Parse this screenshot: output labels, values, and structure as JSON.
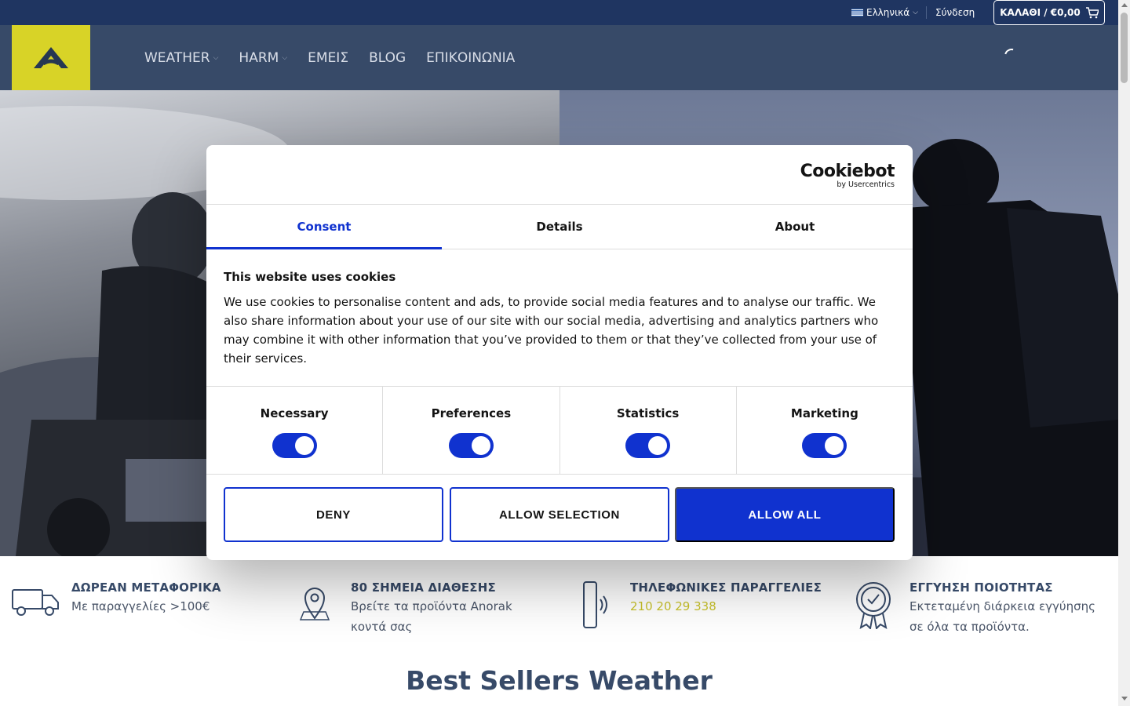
{
  "topbar": {
    "language_label": "Ελληνικά",
    "login_label": "Σύνδεση",
    "cart_label": "ΚΑΛΑΘΙ / €0,00"
  },
  "nav": {
    "items": [
      {
        "label": "WEATHER",
        "has_dropdown": true
      },
      {
        "label": "HARM",
        "has_dropdown": true
      },
      {
        "label": "ΕΜΕΙΣ",
        "has_dropdown": false
      },
      {
        "label": "BLOG",
        "has_dropdown": false
      },
      {
        "label": "ΕΠΙΚΟΙΝΩΝΙΑ",
        "has_dropdown": false
      }
    ]
  },
  "cookie": {
    "brand": "Cookiebot",
    "brand_sub": "by Usercentrics",
    "tabs": [
      "Consent",
      "Details",
      "About"
    ],
    "active_tab": "Consent",
    "title": "This website uses cookies",
    "body": "We use cookies to personalise content and ads, to provide social media features and to analyse our traffic. We also share information about your use of our site with our social media, advertising and analytics partners who may combine it with other information that you’ve provided to them or that they’ve collected from your use of their services.",
    "categories": [
      {
        "label": "Necessary",
        "enabled": true
      },
      {
        "label": "Preferences",
        "enabled": true
      },
      {
        "label": "Statistics",
        "enabled": true
      },
      {
        "label": "Marketing",
        "enabled": true
      }
    ],
    "buttons": {
      "deny": "DENY",
      "allow_selection": "ALLOW SELECTION",
      "allow_all": "ALLOW ALL"
    }
  },
  "features": [
    {
      "icon": "truck-icon",
      "title": "ΔΩΡΕΑΝ ΜΕΤΑΦΟΡΙΚΑ",
      "text": "Με παραγγελίες >100€"
    },
    {
      "icon": "map-pin-icon",
      "title": "80 ΣΗΜΕΙΑ ΔΙΑΘΕΣΗΣ",
      "text": "Βρείτε τα προϊόντα Anorak κοντά σας"
    },
    {
      "icon": "phone-icon",
      "title": "ΤΗΛΕΦΩΝΙΚΕΣ ΠΑΡΑΓΓΕΛΙΕΣ",
      "text": "210 20 29 338"
    },
    {
      "icon": "award-badge-icon",
      "title": "ΕΓΓΥΗΣΗ ΠΟΙΟΤΗΤΑΣ",
      "text": "Εκτεταμένη διάρκεια εγγύησης σε όλα τα προϊόντα."
    }
  ],
  "section_title": "Best Sellers Weather",
  "colors": {
    "topbar_bg": "#1f3561",
    "header_bg": "#374a68",
    "logo_bg": "#d8d327",
    "cookie_accent": "#1032cf",
    "phone_link": "#c9c22a"
  }
}
